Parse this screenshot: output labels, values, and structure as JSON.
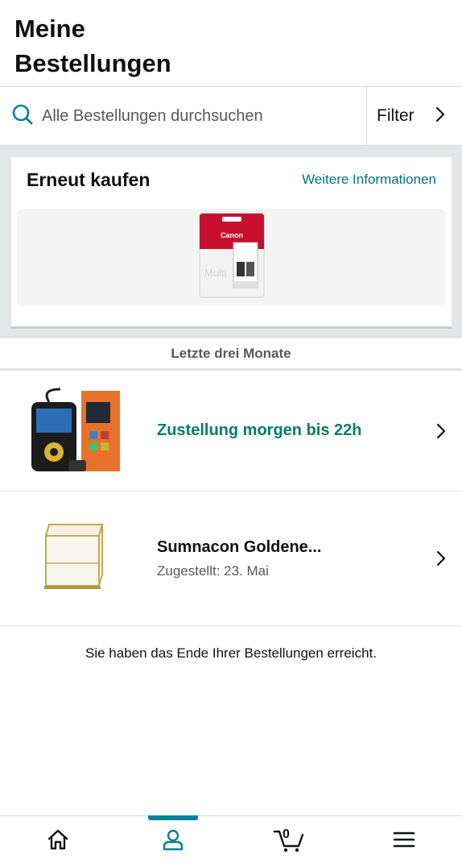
{
  "header": {
    "title": "Meine Bestellungen"
  },
  "search": {
    "placeholder": "Alle Bestellungen durchsuchen",
    "icon": "search-icon"
  },
  "filter": {
    "label": "Filter",
    "icon": "chevron-right-icon"
  },
  "buy_again": {
    "title": "Erneut kaufen",
    "more_info_label": "Weitere Informationen",
    "products": [
      {
        "image": "canon-ink-cartridge-pack",
        "brand_text": "Canon",
        "pack_text": "Multi"
      }
    ]
  },
  "section": {
    "label": "Letzte drei Monate"
  },
  "orders": [
    {
      "image": "obd2-scanner",
      "delivery_text": "Zustellung morgen bis 22h",
      "status_color": "#067d62"
    },
    {
      "image": "gold-glass-box",
      "title": "Sumnacon Goldene...",
      "status": "Zugestellt: 23. Mai"
    }
  ],
  "end_message": "Sie haben das Ende Ihrer Bestellungen erreicht.",
  "bottom_nav": {
    "items": [
      {
        "name": "home",
        "icon": "home-icon"
      },
      {
        "name": "account",
        "icon": "person-icon",
        "active": true
      },
      {
        "name": "cart",
        "icon": "cart-icon",
        "count": "0"
      },
      {
        "name": "menu",
        "icon": "hamburger-menu-icon"
      }
    ],
    "active_color": "#008296"
  },
  "colors": {
    "link": "#007185",
    "delivery_green": "#067d62",
    "accent": "#008296"
  }
}
